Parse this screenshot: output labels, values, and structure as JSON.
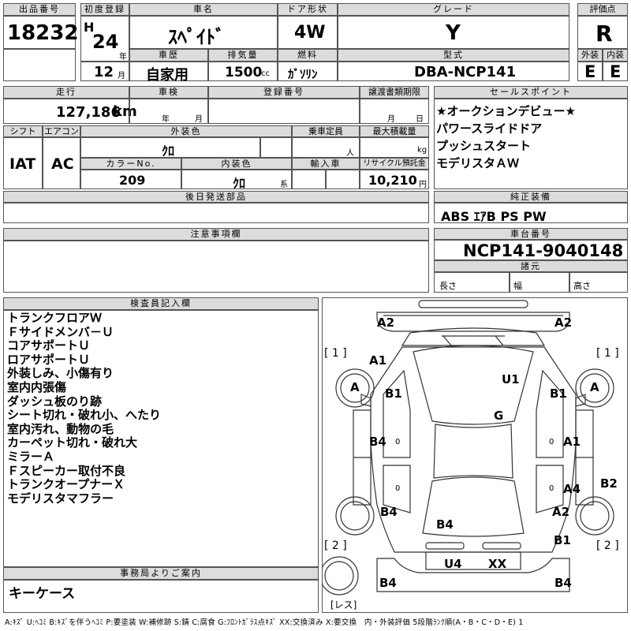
{
  "header": {
    "lot_number_label": "出品番号",
    "lot_number": "18232",
    "first_reg_label": "初度登録",
    "era": "H",
    "reg_year": "24",
    "year_unit": "年",
    "reg_month": "12",
    "month_unit": "月",
    "car_name_label": "車名",
    "car_name": "ｽﾍﾟｲﾄﾞ",
    "door_label": "ドア形状",
    "door": "4W",
    "grade_label": "グレード",
    "grade": "Y",
    "score_label": "評価点",
    "score": "R",
    "history_label": "車歴",
    "history": "自家用",
    "displacement_label": "排気量",
    "displacement": "1500",
    "displacement_unit": "cc",
    "fuel_label": "燃料",
    "fuel": "ｶﾞｿﾘﾝ",
    "model_label": "型式",
    "model": "DBA-NCP141",
    "exterior_label": "外装",
    "exterior_grade": "E",
    "interior_label": "内装",
    "interior_grade": "E"
  },
  "row2": {
    "mileage_label": "走行",
    "mileage": "127,186",
    "mileage_unit": "km",
    "inspection_label": "車検",
    "inspection_year_unit": "年",
    "inspection_month_unit": "月",
    "reg_number_label": "登録番号",
    "transfer_label": "譲渡書類期限",
    "transfer_month_unit": "月",
    "transfer_day_unit": "日",
    "shift_label": "シフト",
    "shift": "IAT",
    "aircon_label": "エアコン",
    "aircon": "AC",
    "ext_color_label": "外装色",
    "ext_color": "ｸﾛ",
    "capacity_label": "乗車定員",
    "capacity_unit": "人",
    "max_load_label": "最大積載量",
    "max_load_unit": "kg",
    "color_no_label": "カラーNo.",
    "color_no": "209",
    "int_color_label": "内装色",
    "int_color": "ｸﾛ",
    "int_color_unit": "系",
    "import_label": "輸入車",
    "recycle_label": "リサイクル預託金",
    "recycle": "10,210",
    "recycle_unit": "円",
    "later_parts_label": "後日発送部品"
  },
  "sales_points": {
    "label": "セールスポイント",
    "items": [
      "★オークションデビュー★",
      "パワースライドドア",
      "プッシュスタート",
      "モデリスタＡＷ"
    ]
  },
  "equipment": {
    "label": "純正装備",
    "value": "ABS ｴｱB PS PW"
  },
  "notes": {
    "label": "注意事項欄"
  },
  "chassis": {
    "label": "車台番号",
    "value": "NCP141-9040148",
    "specs_label": "諸元",
    "length_label": "長さ",
    "width_label": "幅",
    "height_label": "高さ"
  },
  "inspector": {
    "label": "検査員記入欄",
    "items": [
      "トランクフロアＷ",
      "Ｆサイドメンバ－Ｕ",
      "コアサポートＵ",
      "ロアサポートＵ",
      "外装しみ、小傷有り",
      "室内内張傷",
      "ダッシュ板のり跡",
      "シート切れ・破れ小、へたり",
      "室内汚れ、動物の毛",
      "カーペット切れ・破れ大",
      "ミラーＡ",
      "Ｆスピーカー取付不良",
      "トランクオープナーＸ",
      "モデリスタマフラー"
    ]
  },
  "office": {
    "label": "事務局よりご案内",
    "value": "キーケース"
  },
  "diagram": {
    "marks": [
      "A2",
      "A2",
      "A1",
      "U1",
      "A",
      "B1",
      "B1",
      "A",
      "G",
      "B4",
      "A1",
      "B2",
      "A4",
      "B4",
      "A2",
      "B4",
      "B1",
      "U4",
      "XX",
      "B4",
      "B4"
    ],
    "bracket_labels": [
      "[ 1 ]",
      "[ 1 ]",
      "[ 2 ]",
      "[ 2 ]",
      "[レス]"
    ]
  },
  "legend": "A:ｷｽﾞ U:ﾍｺﾐ B:ｷｽﾞを伴うﾍｺﾐ P:要塗装 W:補修跡 S:錆 C:腐食 G:ﾌﾛﾝﾄｶﾞﾗｽ点ｷｽﾞ XX:交換済み X:要交換　内・外装評価 5段階ﾗﾝｸ順(A・B・C・D・E) 1"
}
